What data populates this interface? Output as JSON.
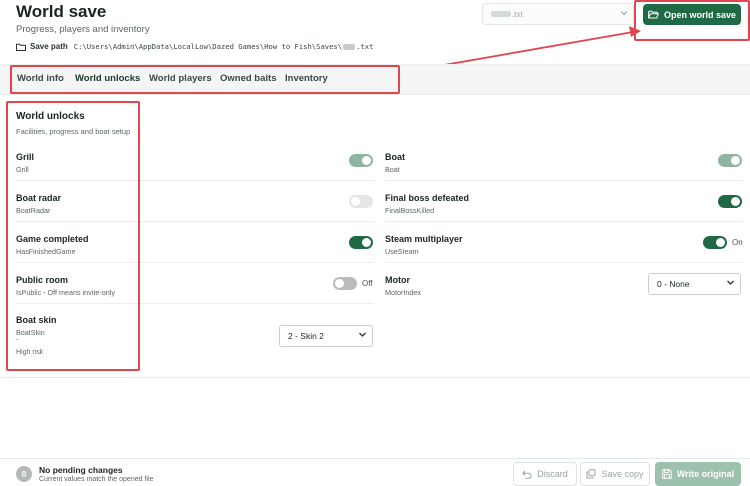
{
  "header": {
    "title": "World save",
    "subtitle": "Progress, players and inventory",
    "save_path_label": "Save path",
    "save_path_prefix": "C:\\Users\\Admin\\AppData\\LocalLow\\Dazed Games\\How to Fish\\Saves\\",
    "save_path_suffix": ".txt",
    "file_select_value": ".txt",
    "open_button_label": "Open world save"
  },
  "tabs": [
    {
      "label": "World info",
      "active": false
    },
    {
      "label": "World unlocks",
      "active": true
    },
    {
      "label": "World players",
      "active": false
    },
    {
      "label": "Owned baits",
      "active": false
    },
    {
      "label": "Inventory",
      "active": false
    }
  ],
  "section": {
    "title": "World unlocks",
    "subtitle": "Facilities, progress and boat setup"
  },
  "settings": {
    "grill": {
      "label": "Grill",
      "key": "Grill",
      "state": "on"
    },
    "boat": {
      "label": "Boat",
      "key": "Boat",
      "state": "on"
    },
    "boat_radar": {
      "label": "Boat radar",
      "key": "BoatRadar",
      "state": "off"
    },
    "final_boss": {
      "label": "Final boss defeated",
      "key": "FinalBossKilled",
      "state": "on"
    },
    "game_completed": {
      "label": "Game completed",
      "key": "HasFinishedGame",
      "state": "on"
    },
    "steam_multiplayer": {
      "label": "Steam multiplayer",
      "key": "UseSteam",
      "state": "on",
      "state_text": "On"
    },
    "public_room": {
      "label": "Public room",
      "key": "IsPublic - Off means invite-only",
      "state": "off",
      "state_text": "Off"
    },
    "motor": {
      "label": "Motor",
      "key": "MotorIndex",
      "value": "0 - None"
    },
    "boat_skin": {
      "label": "Boat skin",
      "key": "BoatSkin",
      "dash": "-",
      "risk": "High risk",
      "value": "2 - Skin 2"
    }
  },
  "footer": {
    "pending_count": "0",
    "pending_title": "No pending changes",
    "pending_sub": "Current values match the opened file",
    "discard_label": "Discard",
    "save_copy_label": "Save copy",
    "write_label": "Write original"
  },
  "colors": {
    "accent": "#1f6a45",
    "annotation": "#e0464d"
  }
}
